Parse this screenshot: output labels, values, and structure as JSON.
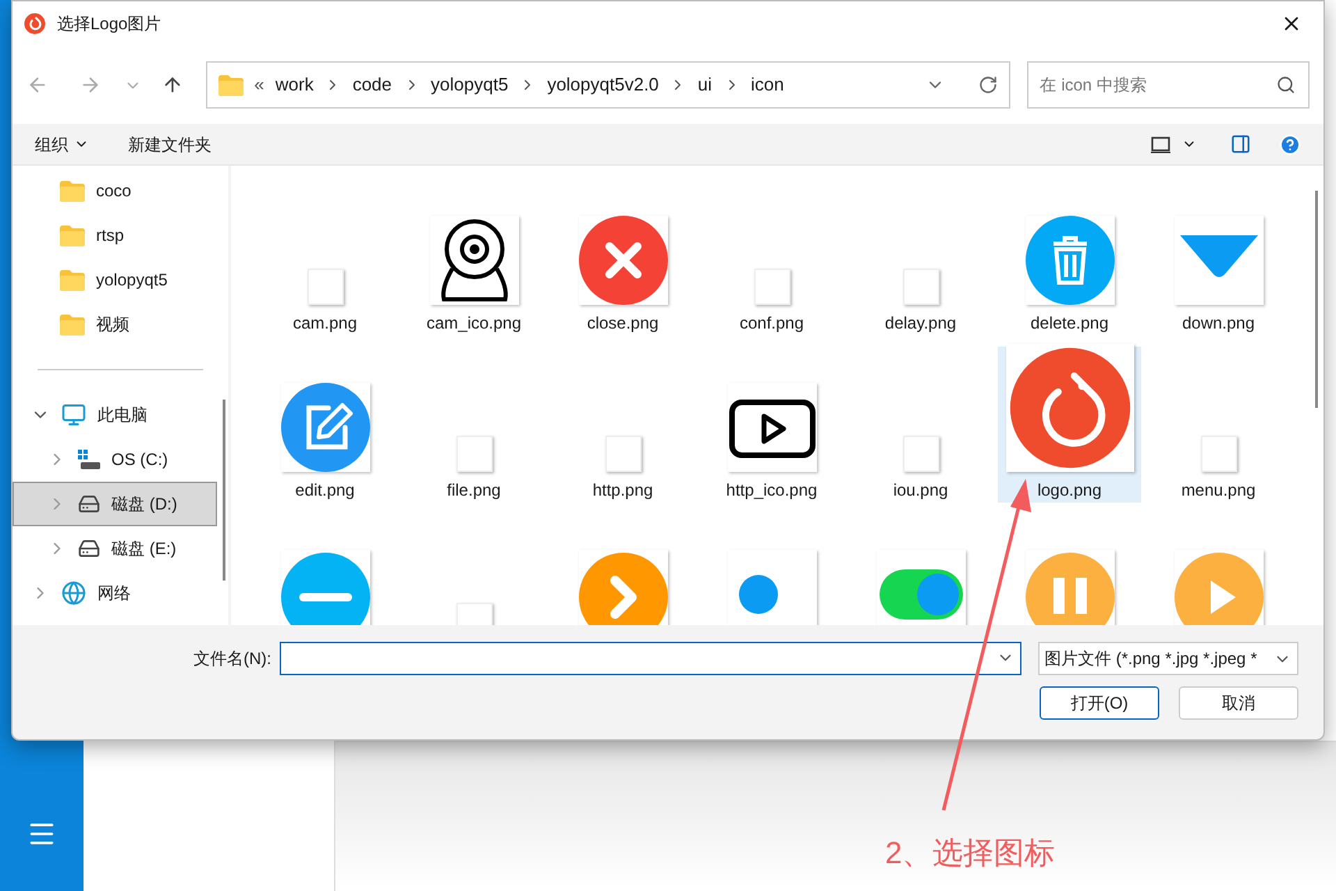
{
  "window": {
    "title": "选择Logo图片"
  },
  "address": {
    "overflow": "«",
    "segments": [
      "work",
      "code",
      "yolopyqt5",
      "yolopyqt5v2.0",
      "ui",
      "icon"
    ]
  },
  "search": {
    "placeholder": "在 icon 中搜索"
  },
  "toolbar": {
    "organize": "组织",
    "new_folder": "新建文件夹"
  },
  "sidebar": {
    "quick": [
      {
        "label": "coco",
        "kind": "folder"
      },
      {
        "label": "rtsp",
        "kind": "folder"
      },
      {
        "label": "yolopyqt5",
        "kind": "folder"
      },
      {
        "label": "视频",
        "kind": "folder"
      }
    ],
    "tree": [
      {
        "label": "此电脑",
        "kind": "pc",
        "expanded": true,
        "selected": false,
        "children": [
          {
            "label": "OS (C:)",
            "kind": "os-drive",
            "expanded": false,
            "selected": false
          },
          {
            "label": "磁盘 (D:)",
            "kind": "drive",
            "expanded": false,
            "selected": true
          },
          {
            "label": "磁盘 (E:)",
            "kind": "drive",
            "expanded": false,
            "selected": false
          }
        ]
      },
      {
        "label": "网络",
        "kind": "network",
        "expanded": false,
        "selected": false
      }
    ]
  },
  "files": [
    {
      "name": "cam.png",
      "kind": "blank",
      "selected": false
    },
    {
      "name": "cam_ico.png",
      "kind": "webcam",
      "selected": false
    },
    {
      "name": "close.png",
      "kind": "close",
      "selected": false
    },
    {
      "name": "conf.png",
      "kind": "blank",
      "selected": false
    },
    {
      "name": "delay.png",
      "kind": "blank",
      "selected": false
    },
    {
      "name": "delete.png",
      "kind": "trash",
      "selected": false
    },
    {
      "name": "down.png",
      "kind": "down",
      "selected": false
    },
    {
      "name": "edit.png",
      "kind": "edit",
      "selected": false
    },
    {
      "name": "file.png",
      "kind": "blank",
      "selected": false
    },
    {
      "name": "http.png",
      "kind": "blank",
      "selected": false
    },
    {
      "name": "http_ico.png",
      "kind": "playbox",
      "selected": false
    },
    {
      "name": "iou.png",
      "kind": "blank",
      "selected": false
    },
    {
      "name": "logo.png",
      "kind": "logo",
      "selected": true
    },
    {
      "name": "menu.png",
      "kind": "blank",
      "selected": false
    },
    {
      "kind": "minus",
      "selected": false
    },
    {
      "kind": "blank",
      "selected": false
    },
    {
      "kind": "next",
      "selected": false
    },
    {
      "kind": "dot",
      "selected": false
    },
    {
      "kind": "toggle",
      "selected": false
    },
    {
      "kind": "pause",
      "selected": false
    },
    {
      "kind": "play",
      "selected": false
    }
  ],
  "footer": {
    "filename_label": "文件名(N):",
    "filter": "图片文件 (*.png *.jpg *.jpeg *",
    "open": "打开(O)",
    "cancel": "取消"
  },
  "annotation": {
    "text": "2、选择图标"
  }
}
